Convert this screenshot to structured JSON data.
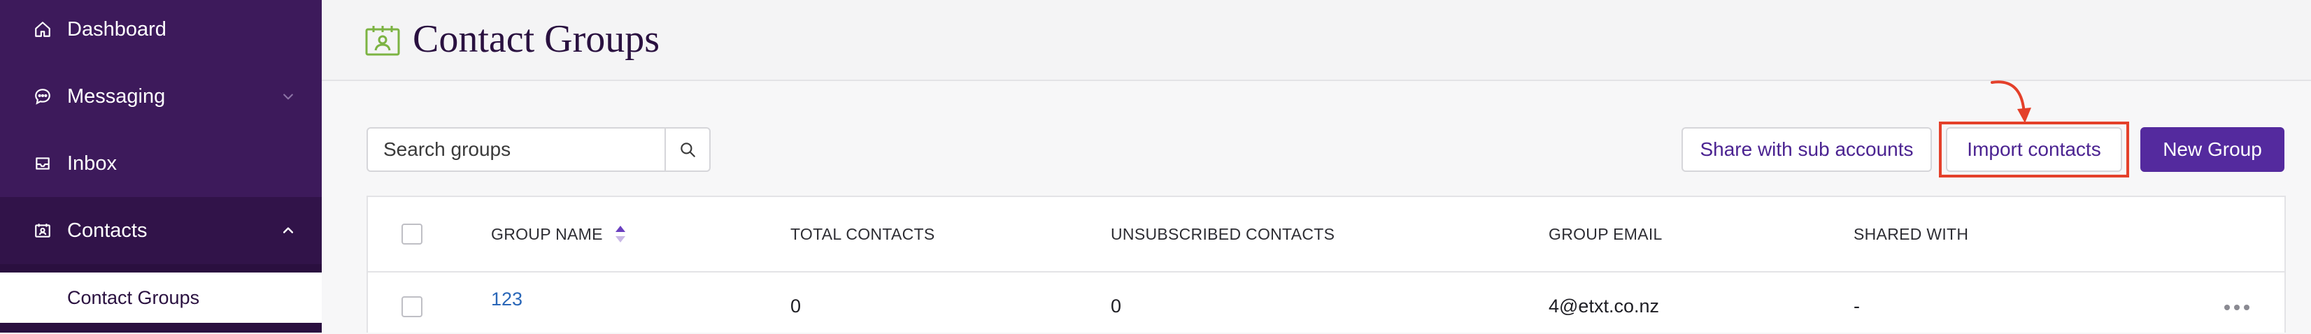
{
  "sidebar": {
    "items": [
      {
        "label": "Dashboard",
        "icon": "home-icon"
      },
      {
        "label": "Messaging",
        "icon": "chat-bubble-icon"
      },
      {
        "label": "Inbox",
        "icon": "inbox-icon"
      },
      {
        "label": "Contacts",
        "icon": "contacts-icon"
      }
    ],
    "subitems": [
      {
        "label": "Contact Groups"
      }
    ]
  },
  "header": {
    "title": "Contact Groups",
    "icon": "contact-group-calendar-icon"
  },
  "toolbar": {
    "search_placeholder": "Search groups",
    "share_label": "Share with sub accounts",
    "import_label": "Import contacts",
    "new_group_label": "New Group"
  },
  "table": {
    "columns": [
      "GROUP NAME",
      "TOTAL CONTACTS",
      "UNSUBSCRIBED CONTACTS",
      "GROUP EMAIL",
      "SHARED WITH"
    ],
    "rows": [
      {
        "group_name": "123",
        "total_contacts": "0",
        "unsubscribed_contacts": "0",
        "group_email": "4@etxt.co.nz",
        "shared_with": "-"
      }
    ]
  },
  "colors": {
    "sidebar_bg": "#3d1a5b",
    "accent": "#542a9e",
    "highlight": "#e4402a",
    "link": "#2a67b8",
    "title_icon": "#7cb342"
  }
}
